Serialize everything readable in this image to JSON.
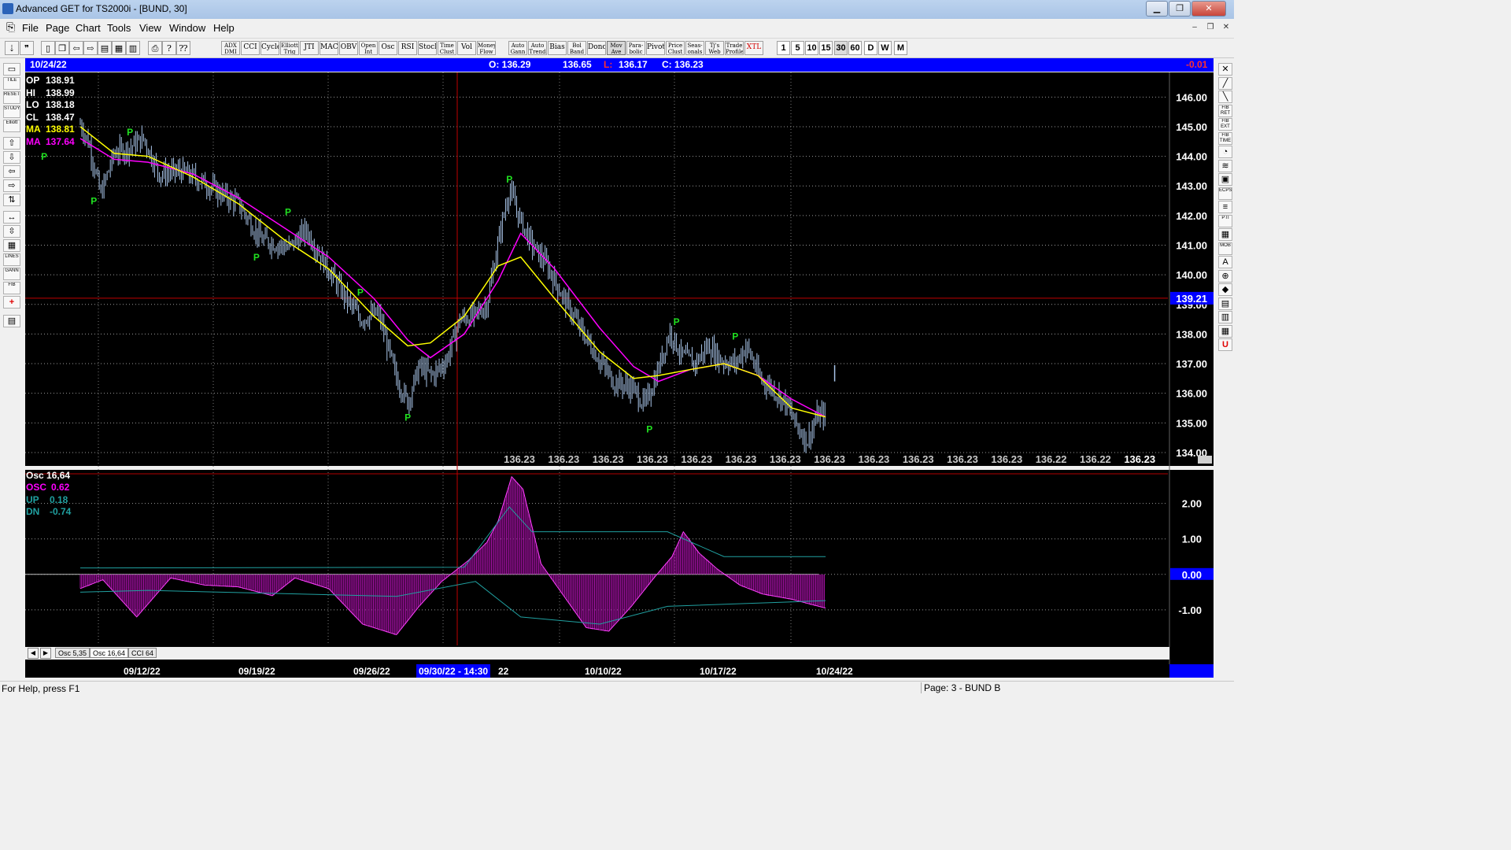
{
  "window": {
    "title": "Advanced GET for TS2000i - [BUND, 30]",
    "minimize": "▁",
    "maximize": "❐",
    "close": "✕"
  },
  "menu": [
    "File",
    "Page",
    "Chart",
    "Tools",
    "View",
    "Window",
    "Help"
  ],
  "mdi": {
    "minimize": "–",
    "restore": "❐",
    "close": "✕"
  },
  "toolbar_labels": [
    "ADX\nDMI",
    "CCI",
    "Cycles",
    "Elliott\nTrig",
    "JTI",
    "MACD",
    "OBV",
    "Open\nInt",
    "Osc",
    "RSI",
    "Stoch",
    "Time\nClust",
    "Vol",
    "Money\nFlow",
    "Auto\nGann",
    "Auto\nTrend",
    "Bias",
    "Bol\nBand",
    "Donch",
    "Mov\nAve",
    "Para-\nbolic",
    "Pivot",
    "Price\nClust",
    "Seas-\nonals",
    "Tj's\nWeb",
    "Trade\nProfile",
    "XTL"
  ],
  "timeframes": [
    "1",
    "5",
    "10",
    "15",
    "30",
    "60",
    "D",
    "W",
    "M"
  ],
  "active_timeframe": "30",
  "left_tools": [
    "▭",
    "TILE",
    "RESET",
    "STUDY",
    "Elliott",
    "⇧",
    "⇩",
    "⇦",
    "⇨",
    "⇅",
    "↔",
    "⇳",
    "▦",
    "LINES",
    "GANN",
    "FIB",
    "+",
    "▤"
  ],
  "right_tools": [
    "✕",
    "╱",
    "╲",
    "FIB RET",
    "FIB EXT",
    "FIB TIME",
    "◔",
    "≋",
    "▣",
    "ECPS",
    "≡",
    "PTI",
    "▦",
    "MOB",
    "A",
    "⊕",
    "◆",
    "▤",
    "▥",
    "▦",
    "U"
  ],
  "infobar": {
    "date": "10/24/22",
    "open": "O: 136.29",
    "high": "136.65",
    "low_label": "L:",
    "low": "136.17",
    "close": "C: 136.23",
    "change": "-0.01"
  },
  "stats": [
    {
      "label": "OP",
      "value": "138.91",
      "color": "#ffffff"
    },
    {
      "label": "HI",
      "value": "138.99",
      "color": "#ffffff"
    },
    {
      "label": "LO",
      "value": "138.18",
      "color": "#ffffff"
    },
    {
      "label": "CL",
      "value": "138.47",
      "color": "#ffffff"
    },
    {
      "label": "MA",
      "value": "138.81",
      "color": "#ffff00"
    },
    {
      "label": "MA",
      "value": "137.64",
      "color": "#ff00ff"
    }
  ],
  "price_axis": [
    "146.00",
    "145.00",
    "144.00",
    "143.00",
    "142.00",
    "141.00",
    "140.00",
    "139.00",
    "138.00",
    "137.00",
    "136.00",
    "135.00",
    "134.00"
  ],
  "crosshair_price": "139.21",
  "bottom_prices": [
    "136.23",
    "136.23",
    "136.23",
    "136.23",
    "136.23",
    "136.23",
    "136.23",
    "136.23",
    "136.23",
    "136.23",
    "136.23",
    "136.23",
    "136.22",
    "136.22",
    "136.23"
  ],
  "pivot_label": "P",
  "osc_panel": {
    "title": "Osc 16,64",
    "lines": [
      {
        "label": "OSC",
        "value": "0.62",
        "color": "#ff00ff"
      },
      {
        "label": "UP",
        "value": "0.18",
        "color": "#20a0a0"
      },
      {
        "label": "DN",
        "value": "-0.74",
        "color": "#20a0a0"
      }
    ],
    "axis": [
      "2.00",
      "1.00",
      "0.00",
      "-1.00"
    ]
  },
  "tabs": [
    "Osc 5,35",
    "Osc 16,64",
    "CCI 64"
  ],
  "active_tab": "Osc 16,64",
  "dates": [
    "09/12/22",
    "09/19/22",
    "09/26/22",
    "10/10/22",
    "10/17/22",
    "10/24/22"
  ],
  "crosshair_date": "09/30/22 - 14:30",
  "crosshair_date_suffix": "22",
  "status": {
    "help": "For Help, press F1",
    "page": "Page: 3 - BUND B"
  },
  "chart_data": {
    "type": "line",
    "ylim": [
      133.6,
      146.7
    ],
    "price_path": [
      [
        0,
        145.1
      ],
      [
        4,
        144.4
      ],
      [
        9,
        142.7
      ],
      [
        15,
        144.1
      ],
      [
        22,
        144.3
      ],
      [
        28,
        144.6
      ],
      [
        35,
        143.4
      ],
      [
        45,
        143.5
      ],
      [
        55,
        143.1
      ],
      [
        63,
        142.7
      ],
      [
        70,
        142.4
      ],
      [
        80,
        141.2
      ],
      [
        92,
        140.9
      ],
      [
        100,
        141.5
      ],
      [
        108,
        140.4
      ],
      [
        116,
        139.4
      ],
      [
        124,
        138.5
      ],
      [
        132,
        138.7
      ],
      [
        140,
        136.5
      ],
      [
        145,
        135.7
      ],
      [
        150,
        136.9
      ],
      [
        156,
        136.6
      ],
      [
        162,
        137.1
      ],
      [
        168,
        138.5
      ],
      [
        174,
        138.6
      ],
      [
        180,
        139.0
      ],
      [
        186,
        141.5
      ],
      [
        190,
        142.9
      ],
      [
        194,
        142.0
      ],
      [
        200,
        141.0
      ],
      [
        206,
        140.4
      ],
      [
        214,
        139.2
      ],
      [
        222,
        138.1
      ],
      [
        230,
        137.1
      ],
      [
        236,
        136.4
      ],
      [
        244,
        136.2
      ],
      [
        250,
        135.6
      ],
      [
        255,
        136.6
      ],
      [
        261,
        138.1
      ],
      [
        266,
        137.3
      ],
      [
        272,
        137.0
      ],
      [
        278,
        137.6
      ],
      [
        284,
        137.1
      ],
      [
        290,
        137.0
      ],
      [
        295,
        137.6
      ],
      [
        301,
        136.5
      ],
      [
        306,
        136.2
      ],
      [
        312,
        135.7
      ],
      [
        318,
        134.8
      ],
      [
        322,
        134.4
      ],
      [
        326,
        135.2
      ],
      [
        330,
        135.3
      ]
    ],
    "ma_fast": [
      [
        0,
        145.0
      ],
      [
        15,
        144.1
      ],
      [
        30,
        144.0
      ],
      [
        50,
        143.3
      ],
      [
        70,
        142.4
      ],
      [
        90,
        141.2
      ],
      [
        110,
        140.2
      ],
      [
        130,
        138.6
      ],
      [
        145,
        137.6
      ],
      [
        155,
        137.7
      ],
      [
        170,
        138.6
      ],
      [
        185,
        140.3
      ],
      [
        195,
        140.6
      ],
      [
        210,
        139.2
      ],
      [
        230,
        137.4
      ],
      [
        245,
        136.5
      ],
      [
        256,
        136.6
      ],
      [
        270,
        136.8
      ],
      [
        285,
        137.0
      ],
      [
        300,
        136.6
      ],
      [
        315,
        135.5
      ],
      [
        330,
        135.2
      ]
    ],
    "ma_slow": [
      [
        0,
        144.6
      ],
      [
        15,
        143.9
      ],
      [
        30,
        143.8
      ],
      [
        50,
        143.4
      ],
      [
        70,
        142.6
      ],
      [
        90,
        141.6
      ],
      [
        110,
        140.6
      ],
      [
        130,
        139.2
      ],
      [
        145,
        137.8
      ],
      [
        155,
        137.2
      ],
      [
        170,
        138.0
      ],
      [
        185,
        139.8
      ],
      [
        195,
        141.4
      ],
      [
        210,
        140.2
      ],
      [
        230,
        138.2
      ],
      [
        245,
        136.9
      ],
      [
        256,
        136.4
      ],
      [
        270,
        136.8
      ],
      [
        285,
        137.0
      ],
      [
        300,
        136.6
      ],
      [
        315,
        135.8
      ],
      [
        330,
        135.2
      ]
    ],
    "pivots": [
      {
        "x": -16,
        "y": 144.2,
        "dir": "low"
      },
      {
        "x": 6,
        "y": 142.7,
        "dir": "low"
      },
      {
        "x": 22,
        "y": 144.6,
        "dir": "high"
      },
      {
        "x": 78,
        "y": 140.8,
        "dir": "low"
      },
      {
        "x": 92,
        "y": 141.9,
        "dir": "high"
      },
      {
        "x": 124,
        "y": 139.2,
        "dir": "high"
      },
      {
        "x": 145,
        "y": 135.4,
        "dir": "low"
      },
      {
        "x": 190,
        "y": 143.0,
        "dir": "high"
      },
      {
        "x": 252,
        "y": 135.0,
        "dir": "low"
      },
      {
        "x": 264,
        "y": 138.2,
        "dir": "high"
      },
      {
        "x": 290,
        "y": 137.7,
        "dir": "high"
      }
    ],
    "last_print": 136.6,
    "osc_path": [
      [
        0,
        -0.4
      ],
      [
        10,
        -0.15
      ],
      [
        25,
        -1.2
      ],
      [
        40,
        -0.1
      ],
      [
        55,
        -0.3
      ],
      [
        70,
        -0.35
      ],
      [
        85,
        -0.6
      ],
      [
        95,
        -0.1
      ],
      [
        110,
        -0.4
      ],
      [
        125,
        -1.4
      ],
      [
        140,
        -1.7
      ],
      [
        150,
        -0.9
      ],
      [
        160,
        -0.2
      ],
      [
        172,
        0.4
      ],
      [
        180,
        0.9
      ],
      [
        185,
        1.5
      ],
      [
        191,
        2.75
      ],
      [
        196,
        2.4
      ],
      [
        204,
        0.3
      ],
      [
        214,
        -0.6
      ],
      [
        224,
        -1.5
      ],
      [
        234,
        -1.6
      ],
      [
        244,
        -0.9
      ],
      [
        254,
        -0.1
      ],
      [
        262,
        0.5
      ],
      [
        267,
        1.2
      ],
      [
        274,
        0.6
      ],
      [
        282,
        0.15
      ],
      [
        292,
        -0.3
      ],
      [
        302,
        -0.55
      ],
      [
        315,
        -0.7
      ],
      [
        330,
        -0.95
      ]
    ],
    "osc_up": [
      [
        0,
        0.18
      ],
      [
        170,
        0.2
      ],
      [
        190,
        1.9
      ],
      [
        200,
        1.2
      ],
      [
        260,
        1.2
      ],
      [
        285,
        0.5
      ],
      [
        330,
        0.5
      ]
    ],
    "osc_dn": [
      [
        0,
        -0.5
      ],
      [
        30,
        -0.45
      ],
      [
        140,
        -0.62
      ],
      [
        175,
        -0.2
      ],
      [
        195,
        -1.2
      ],
      [
        230,
        -1.4
      ],
      [
        260,
        -0.9
      ],
      [
        330,
        -0.74
      ]
    ]
  }
}
